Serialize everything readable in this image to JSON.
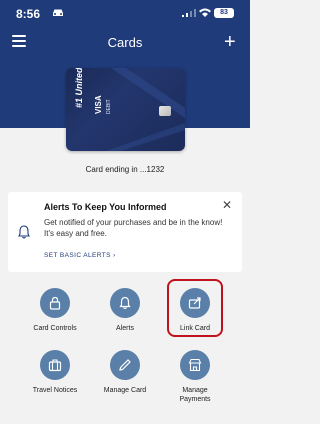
{
  "status_bar": {
    "time": "8:56",
    "battery": "83"
  },
  "header": {
    "title": "Cards"
  },
  "card": {
    "brand": "#1 United",
    "network": "VISA",
    "type": "DEBIT",
    "caption": "Card ending in ...1232"
  },
  "alert": {
    "title": "Alerts To Keep You Informed",
    "text": "Get notified of your purchases and be in the know! It's easy and free.",
    "link": "SET BASIC ALERTS  ›"
  },
  "tiles": [
    {
      "label": "Card Controls",
      "icon": "lock-icon"
    },
    {
      "label": "Alerts",
      "icon": "bell-icon"
    },
    {
      "label": "Link Card",
      "icon": "link-card-icon"
    },
    {
      "label": "Travel Notices",
      "icon": "suitcase-icon"
    },
    {
      "label": "Manage Card",
      "icon": "pencil-icon"
    },
    {
      "label": "Manage\nPayments",
      "icon": "store-icon"
    }
  ],
  "colors": {
    "header": "#1f3b7a",
    "tile": "#5a7fa8",
    "highlight": "#c0121c"
  }
}
